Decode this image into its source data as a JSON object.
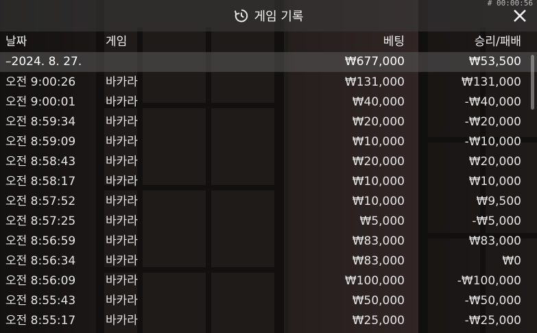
{
  "header": {
    "title": "게임 기록",
    "timer": "# 00:00:56"
  },
  "columns": {
    "date": "날짜",
    "game": "게임",
    "bet": "베팅",
    "result": "승리/패배"
  },
  "summary": {
    "date": "–2024. 8. 27.",
    "bet": "₩677,000",
    "result": "₩53,500"
  },
  "rows": [
    {
      "time": "오전 9:00:26",
      "game": "바카라",
      "bet": "₩131,000",
      "result": "₩131,000"
    },
    {
      "time": "오전 9:00:01",
      "game": "바카라",
      "bet": "₩40,000",
      "result": "-₩40,000"
    },
    {
      "time": "오전 8:59:34",
      "game": "바카라",
      "bet": "₩20,000",
      "result": "-₩20,000"
    },
    {
      "time": "오전 8:59:09",
      "game": "바카라",
      "bet": "₩10,000",
      "result": "-₩10,000"
    },
    {
      "time": "오전 8:58:43",
      "game": "바카라",
      "bet": "₩20,000",
      "result": "₩20,000"
    },
    {
      "time": "오전 8:58:17",
      "game": "바카라",
      "bet": "₩10,000",
      "result": "₩10,000"
    },
    {
      "time": "오전 8:57:52",
      "game": "바카라",
      "bet": "₩10,000",
      "result": "₩9,500"
    },
    {
      "time": "오전 8:57:25",
      "game": "바카라",
      "bet": "₩5,000",
      "result": "-₩5,000"
    },
    {
      "time": "오전 8:56:59",
      "game": "바카라",
      "bet": "₩83,000",
      "result": "₩83,000"
    },
    {
      "time": "오전 8:56:34",
      "game": "바카라",
      "bet": "₩83,000",
      "result": "₩0"
    },
    {
      "time": "오전 8:56:09",
      "game": "바카라",
      "bet": "₩100,000",
      "result": "-₩100,000"
    },
    {
      "time": "오전 8:55:43",
      "game": "바카라",
      "bet": "₩50,000",
      "result": "-₩50,000"
    },
    {
      "time": "오전 8:55:17",
      "game": "바카라",
      "bet": "₩25,000",
      "result": "-₩25,000"
    }
  ],
  "icons": {
    "title": "history-icon",
    "close": "close-icon"
  }
}
